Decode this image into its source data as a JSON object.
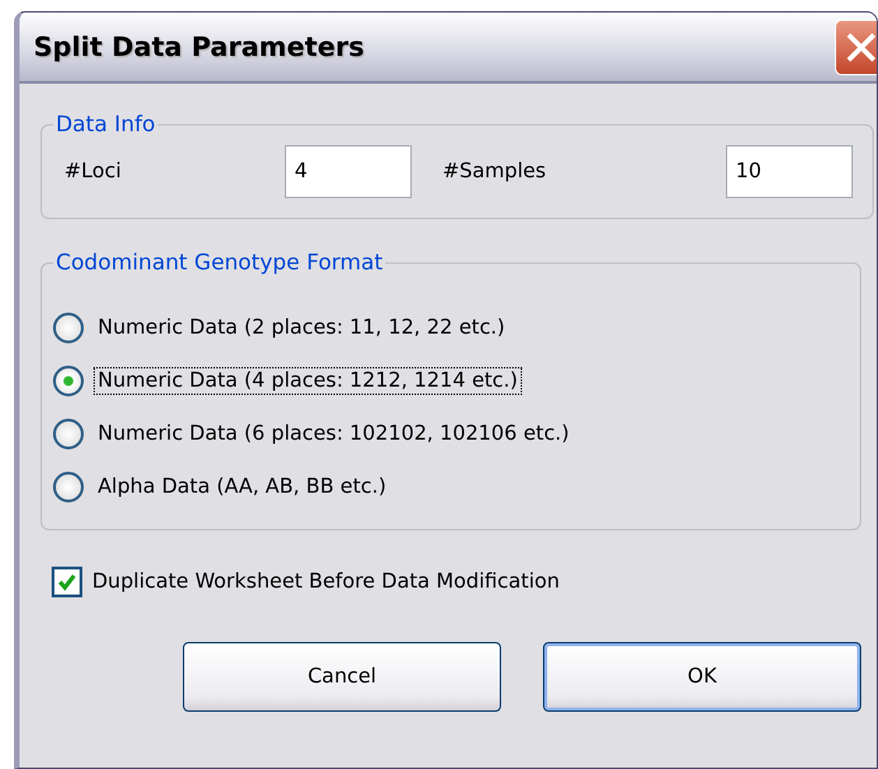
{
  "window": {
    "title": "Split Data Parameters"
  },
  "data_info": {
    "title": "Data Info",
    "fields": [
      {
        "label": "#Loci",
        "value": "4"
      },
      {
        "label": "#Samples",
        "value": "10"
      }
    ]
  },
  "genotype_format": {
    "title": "Codominant Genotype Format",
    "options": [
      {
        "label": "Numeric Data (2 places: 11, 12, 22 etc.)",
        "selected": false
      },
      {
        "label": "Numeric Data (4 places: 1212, 1214 etc.)",
        "selected": true
      },
      {
        "label": "Numeric Data (6 places: 102102, 102106 etc.)",
        "selected": false
      },
      {
        "label": "Alpha Data (AA, AB, BB etc.)",
        "selected": false
      }
    ]
  },
  "duplicate_option": {
    "label": "Duplicate Worksheet Before Data Modification",
    "checked": true
  },
  "buttons": [
    {
      "label": "Cancel",
      "default": false
    },
    {
      "label": "OK",
      "default": true
    }
  ]
}
